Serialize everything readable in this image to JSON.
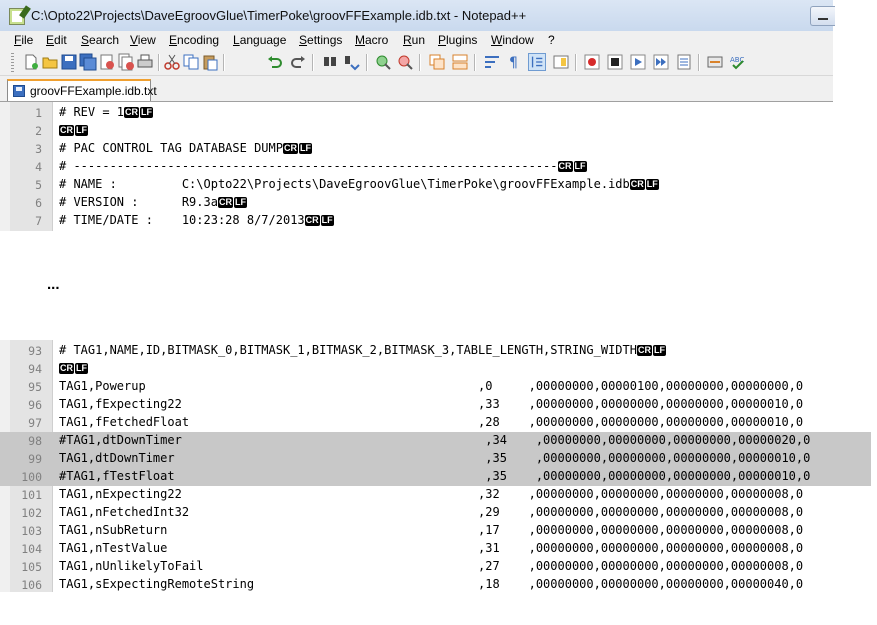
{
  "window": {
    "title": "C:\\Opto22\\Projects\\DaveEgroovGlue\\TimerPoke\\groovFFExample.idb.txt - Notepad++"
  },
  "menu": [
    "File",
    "Edit",
    "Search",
    "View",
    "Encoding",
    "Language",
    "Settings",
    "Macro",
    "Run",
    "Plugins",
    "Window",
    "?"
  ],
  "toolbar": {
    "buttons": [
      "new-file-icon",
      "open-file-icon",
      "save-icon",
      "save-all-icon",
      "close-icon",
      "close-all-icon",
      "print-icon",
      "cut-icon",
      "copy-icon",
      "paste-icon",
      "undo-icon",
      "redo-icon",
      "find-icon",
      "replace-icon",
      "zoom-in-icon",
      "zoom-out-icon",
      "sync-vertical-icon",
      "sync-horizontal-icon",
      "word-wrap-icon",
      "show-all-characters-icon",
      "indent-guide-icon",
      "doc-map-icon",
      "record-macro-icon",
      "stop-record-icon",
      "play-macro-icon",
      "run-macro-multiple-icon",
      "save-macro-icon",
      "trim-icon",
      "spellcheck-icon"
    ]
  },
  "tab": {
    "label": "groovFFExample.idb.txt"
  },
  "eol_marks": {
    "cr": "CR",
    "lf": "LF"
  },
  "editor_top": {
    "lines": [
      {
        "num": "1",
        "text": "# REV = 1",
        "eol": true
      },
      {
        "num": "2",
        "text": "",
        "eol": true
      },
      {
        "num": "3",
        "text": "# PAC CONTROL TAG DATABASE DUMP",
        "eol": true
      },
      {
        "num": "4",
        "text": "# -------------------------------------------------------------------",
        "eol": true
      },
      {
        "num": "5",
        "text": "# NAME :         C:\\Opto22\\Projects\\DaveEgroovGlue\\TimerPoke\\groovFFExample.idb",
        "eol": true
      },
      {
        "num": "6",
        "text": "# VERSION :      R9.3a",
        "eol": true
      },
      {
        "num": "7",
        "text": "# TIME/DATE :    10:23:28 8/7/2013",
        "eol": true
      }
    ]
  },
  "ellipsis": "...",
  "editor_bottom": {
    "lines": [
      {
        "num": "93",
        "text": "# TAG1,NAME,ID,BITMASK_0,BITMASK_1,BITMASK_2,BITMASK_3,TABLE_LENGTH,STRING_WIDTH",
        "eol": true,
        "highlight": false
      },
      {
        "num": "94",
        "text": "",
        "eol": true,
        "highlight": false
      },
      {
        "num": "95",
        "text": "TAG1,Powerup                                              ,0     ,00000000,00000100,00000000,00000000,0",
        "eol": false,
        "highlight": false
      },
      {
        "num": "96",
        "text": "TAG1,fExpecting22                                         ,33    ,00000000,00000000,00000000,00000010,0",
        "eol": false,
        "highlight": false
      },
      {
        "num": "97",
        "text": "TAG1,fFetchedFloat                                        ,28    ,00000000,00000000,00000000,00000010,0",
        "eol": false,
        "highlight": false
      },
      {
        "num": "98",
        "text": "#TAG1,dtDownTimer                                          ,34    ,00000000,00000000,00000000,00000020,0",
        "eol": false,
        "highlight": true
      },
      {
        "num": "99",
        "text": "TAG1,dtDownTimer                                           ,35    ,00000000,00000000,00000000,00000010,0",
        "eol": false,
        "highlight": true
      },
      {
        "num": "100",
        "text": "#TAG1,fTestFloat                                           ,35    ,00000000,00000000,00000000,00000010,0",
        "eol": false,
        "highlight": true
      },
      {
        "num": "101",
        "text": "TAG1,nExpecting22                                         ,32    ,00000000,00000000,00000000,00000008,0",
        "eol": false,
        "highlight": false
      },
      {
        "num": "102",
        "text": "TAG1,nFetchedInt32                                        ,29    ,00000000,00000000,00000000,00000008,0",
        "eol": false,
        "highlight": false
      },
      {
        "num": "103",
        "text": "TAG1,nSubReturn                                           ,17    ,00000000,00000000,00000000,00000008,0",
        "eol": false,
        "highlight": false
      },
      {
        "num": "104",
        "text": "TAG1,nTestValue                                           ,31    ,00000000,00000000,00000000,00000008,0",
        "eol": false,
        "highlight": false
      },
      {
        "num": "105",
        "text": "TAG1,nUnlikelyToFail                                      ,27    ,00000000,00000000,00000000,00000008,0",
        "eol": false,
        "highlight": false
      },
      {
        "num": "106",
        "text": "TAG1,sExpectingRemoteString                               ,18    ,00000000,00000000,00000000,00000040,0",
        "eol": false,
        "highlight": false
      }
    ]
  }
}
